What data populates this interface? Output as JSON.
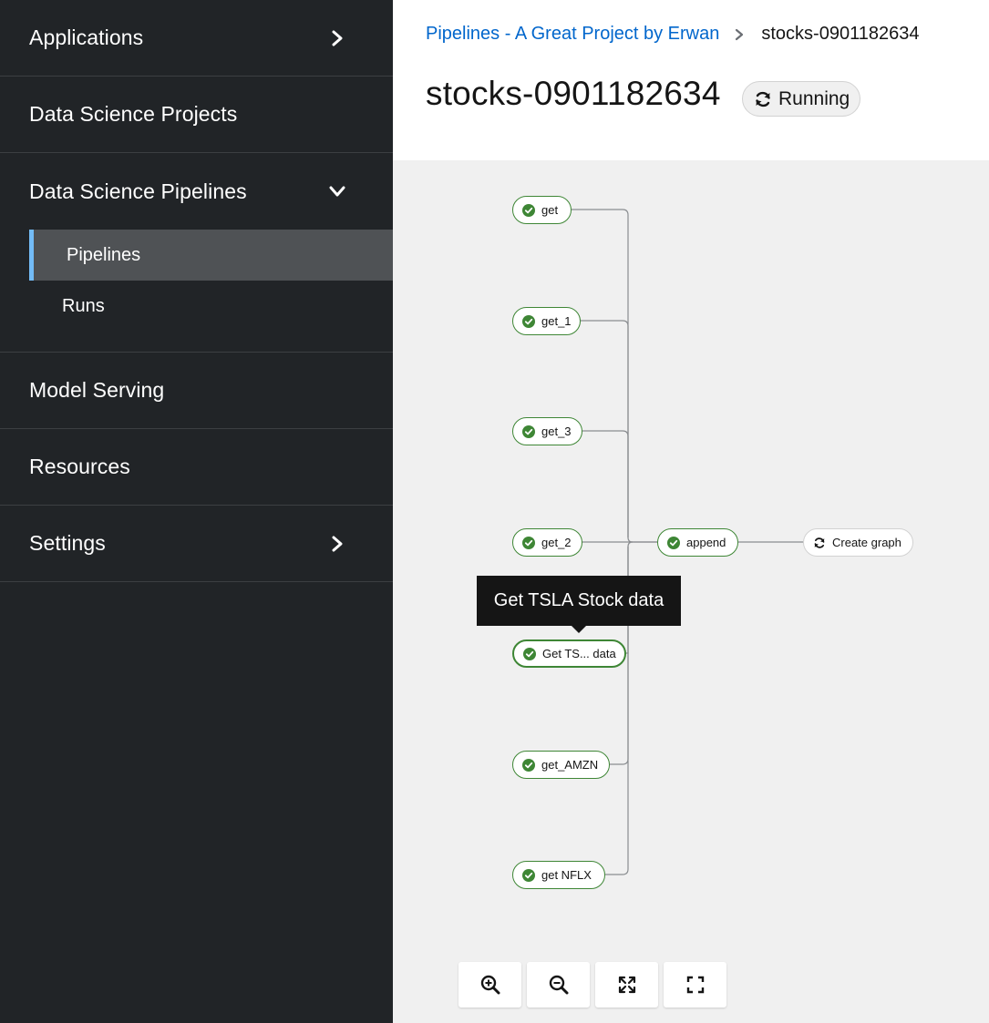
{
  "sidebar": {
    "items": [
      {
        "label": "Applications"
      },
      {
        "label": "Data Science Projects"
      },
      {
        "label": "Data Science Pipelines",
        "children": [
          {
            "label": "Pipelines",
            "active": true
          },
          {
            "label": "Runs"
          }
        ]
      },
      {
        "label": "Model Serving"
      },
      {
        "label": "Resources"
      },
      {
        "label": "Settings"
      }
    ]
  },
  "header": {
    "breadcrumb": {
      "parent": "Pipelines - A Great Project by Erwan",
      "current": "stocks-0901182634"
    },
    "title": "stocks-0901182634",
    "status": "Running"
  },
  "graph": {
    "nodes": [
      {
        "label": "get",
        "state": "succeeded"
      },
      {
        "label": "get_1",
        "state": "succeeded"
      },
      {
        "label": "get_3",
        "state": "succeeded"
      },
      {
        "label": "get_2",
        "state": "succeeded"
      },
      {
        "label": "Get TS... data",
        "state": "succeeded"
      },
      {
        "label": "get_AMZN",
        "state": "succeeded"
      },
      {
        "label": "get NFLX",
        "state": "succeeded"
      },
      {
        "label": "append",
        "state": "succeeded"
      },
      {
        "label": "Create graph",
        "state": "running"
      }
    ],
    "tooltip": "Get TSLA Stock data",
    "controls": [
      {
        "icon": "zoom-in-icon"
      },
      {
        "icon": "zoom-out-icon"
      },
      {
        "icon": "fit-to-screen-icon"
      },
      {
        "icon": "reset-view-icon"
      }
    ]
  },
  "colors": {
    "sidebar_bg": "#212427",
    "active_item_bg": "#4f5255",
    "active_accent": "#73bcf7",
    "link": "#0066cc",
    "success": "#3e8635"
  }
}
